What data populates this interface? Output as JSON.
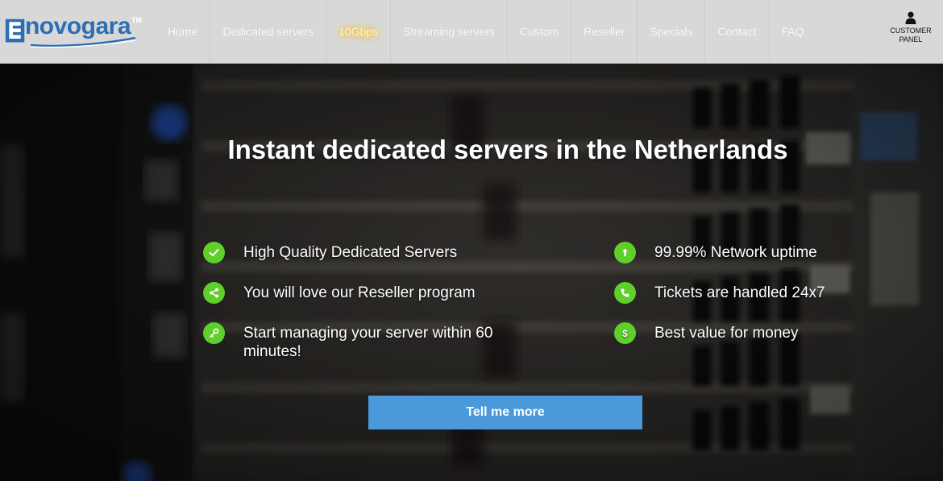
{
  "brand": {
    "logo_text": "novogara",
    "trademark": "TM"
  },
  "nav": {
    "items": [
      {
        "label": "Home",
        "icon": null
      },
      {
        "label": "Dedicated servers"
      },
      {
        "label": "10Gbps",
        "highlight": true
      },
      {
        "label": "Streaming servers"
      },
      {
        "label": "Custom"
      },
      {
        "label": "Reseller"
      },
      {
        "label": "Specials"
      },
      {
        "label": "Contact"
      },
      {
        "label": "FAQ"
      }
    ],
    "customer_panel": {
      "label_line1": "CUSTOMER",
      "label_line2": "PANEL",
      "icon": "user-icon"
    }
  },
  "hero": {
    "title": "Instant dedicated servers in the Netherlands",
    "features_left": [
      {
        "icon": "checkmark-icon",
        "text": "High Quality Dedicated Servers"
      },
      {
        "icon": "share-nodes-icon",
        "text": "You will love our Reseller program"
      },
      {
        "icon": "key-icon",
        "text": "Start managing your server within 60 minutes!"
      }
    ],
    "features_right": [
      {
        "icon": "arrow-up-icon",
        "text": "99.99% Network uptime"
      },
      {
        "icon": "phone-icon",
        "text": "Tickets are handled 24x7"
      },
      {
        "icon": "dollar-icon",
        "text": "Best value for money"
      }
    ],
    "cta_label": "Tell me more"
  },
  "colors": {
    "accent_green": "#5fcf2a",
    "cta_blue": "#4a9adb",
    "logo_blue": "#2d6eb3",
    "nav_bg": "#d8d8d8",
    "highlight_glow": "#ffc21a"
  }
}
